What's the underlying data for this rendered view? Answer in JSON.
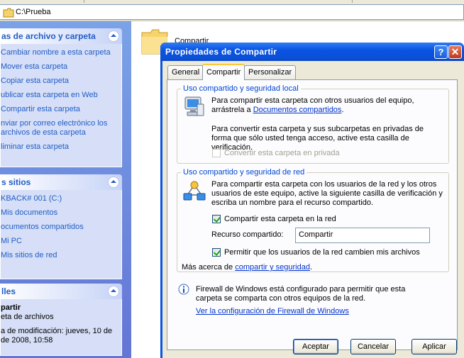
{
  "addressbar": {
    "path": "C:\\Prueba"
  },
  "left": {
    "tasks": {
      "title": "as de archivo y carpeta",
      "items": [
        "Cambiar nombre a esta carpeta",
        "Mover esta carpeta",
        "Copiar esta carpeta",
        "ublicar esta carpeta en Web",
        "Compartir esta carpeta",
        "nviar por correo electrónico los archivos de esta carpeta",
        "liminar esta carpeta"
      ]
    },
    "places": {
      "title": "s sitios",
      "items": [
        "KBACK# 001 (C:)",
        "Mis documentos",
        "ocumentos compartidos",
        "Mi PC",
        "Mis sitios de red"
      ]
    },
    "details": {
      "title": "lles",
      "name": "partir",
      "type": "eta de archivos",
      "modified_1": "a de modificación: jueves, 10 de",
      "modified_2": "de 2008, 10:58"
    }
  },
  "main": {
    "folder_label": "Compartir"
  },
  "dialog": {
    "title": "Propiedades de Compartir",
    "tabs": [
      "General",
      "Compartir",
      "Personalizar"
    ],
    "local": {
      "legend": "Uso compartido y seguridad local",
      "text1": "Para compartir esta carpeta con otros usuarios del equipo, arrástrela a",
      "link1": "Documentos compartidos",
      "text1_end": ".",
      "text2": "Para convertir esta carpeta y sus subcarpetas en privadas de forma que sólo usted tenga acceso, active esta casilla de verificación.",
      "private_label": "Convertir esta carpeta en privada"
    },
    "network": {
      "legend": "Uso compartido y seguridad de red",
      "text": "Para compartir esta carpeta con los usuarios de la red y los otros usuarios de este equipo, active la siguiente casilla de verificación y escriba un nombre para el recurso compartido.",
      "share_label": "Compartir esta carpeta en la red",
      "resource_label": "Recurso compartido:",
      "resource_value": "Compartir",
      "allow_label": "Permitir que los usuarios de la red cambien mis archivos",
      "more_prefix": "Más acerca de ",
      "more_link": "compartir y seguridad",
      "more_end": "."
    },
    "firewall": {
      "text": "Firewall de Windows está configurado para permitir que esta carpeta se comparta con otros equipos de la red.",
      "link": "Ver la configuración de Firewall de Windows"
    },
    "buttons": {
      "ok": "Aceptar",
      "cancel": "Cancelar",
      "apply": "Aplicar"
    }
  }
}
